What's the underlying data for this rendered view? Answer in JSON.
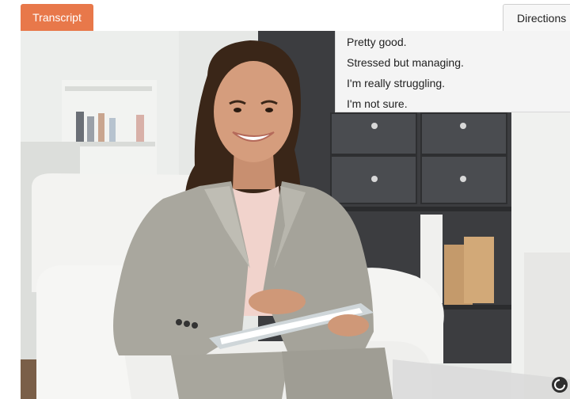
{
  "header": {
    "transcript_label": "Transcript",
    "directions_label": "Directions"
  },
  "colors": {
    "accent": "#e8784a",
    "panel_bg": "#f4f4f4"
  },
  "response_options": [
    "Pretty good.",
    "Stressed but managing.",
    "I'm really struggling.",
    "I'm not sure."
  ],
  "video": {
    "content": "smiling therapist in gray suit seated in white armchair holding clipboard",
    "status_icon": "loading-spinner-icon"
  }
}
